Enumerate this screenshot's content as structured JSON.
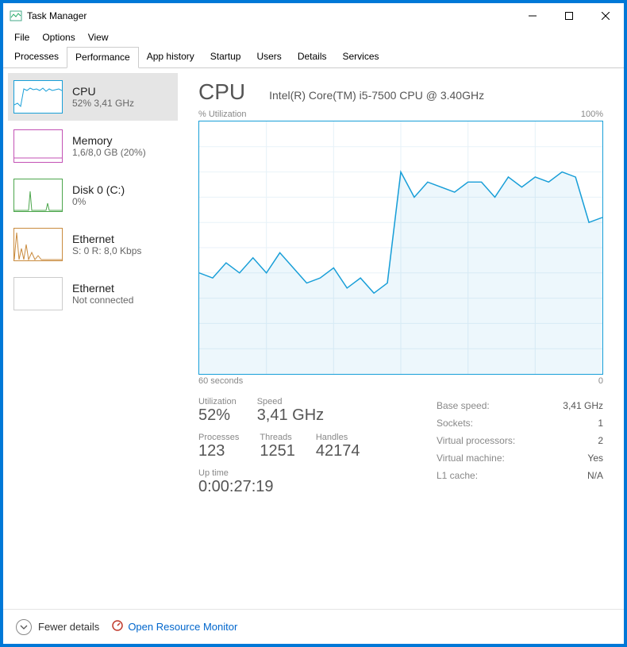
{
  "window": {
    "title": "Task Manager"
  },
  "menu": {
    "file": "File",
    "options": "Options",
    "view": "View"
  },
  "tabs": {
    "processes": "Processes",
    "performance": "Performance",
    "apphistory": "App history",
    "startup": "Startup",
    "users": "Users",
    "details": "Details",
    "services": "Services"
  },
  "sidebar": {
    "items": [
      {
        "name": "CPU",
        "sub": "52%  3,41 GHz"
      },
      {
        "name": "Memory",
        "sub": "1,6/8,0 GB (20%)"
      },
      {
        "name": "Disk 0 (C:)",
        "sub": "0%"
      },
      {
        "name": "Ethernet",
        "sub": "S: 0  R: 8,0 Kbps"
      },
      {
        "name": "Ethernet",
        "sub": "Not connected"
      }
    ]
  },
  "main": {
    "title": "CPU",
    "subtitle": "Intel(R) Core(TM) i5-7500 CPU @ 3.40GHz",
    "chart": {
      "top_left": "% Utilization",
      "top_right": "100%",
      "bottom_left": "60 seconds",
      "bottom_right": "0"
    },
    "stats": {
      "utilization_label": "Utilization",
      "utilization_value": "52%",
      "speed_label": "Speed",
      "speed_value": "3,41 GHz",
      "processes_label": "Processes",
      "processes_value": "123",
      "threads_label": "Threads",
      "threads_value": "1251",
      "handles_label": "Handles",
      "handles_value": "42174",
      "uptime_label": "Up time",
      "uptime_value": "0:00:27:19"
    },
    "info": {
      "base_speed_k": "Base speed:",
      "base_speed_v": "3,41 GHz",
      "sockets_k": "Sockets:",
      "sockets_v": "1",
      "vproc_k": "Virtual processors:",
      "vproc_v": "2",
      "vm_k": "Virtual machine:",
      "vm_v": "Yes",
      "l1_k": "L1 cache:",
      "l1_v": "N/A"
    }
  },
  "footer": {
    "fewer": "Fewer details",
    "resmon": "Open Resource Monitor"
  },
  "chart_data": {
    "type": "line",
    "title": "CPU % Utilization",
    "xlabel": "seconds",
    "ylabel": "% Utilization",
    "xlim": [
      60,
      0
    ],
    "ylim": [
      0,
      100
    ],
    "x": [
      60,
      58,
      56,
      54,
      52,
      50,
      48,
      46,
      44,
      42,
      40,
      38,
      36,
      34,
      32,
      30,
      28,
      26,
      24,
      22,
      20,
      18,
      16,
      14,
      12,
      10,
      8,
      6,
      4,
      2,
      0
    ],
    "values": [
      40,
      38,
      44,
      40,
      46,
      40,
      48,
      42,
      36,
      38,
      42,
      34,
      38,
      32,
      36,
      80,
      70,
      76,
      74,
      72,
      76,
      76,
      70,
      78,
      74,
      78,
      76,
      80,
      78,
      60,
      62
    ]
  }
}
